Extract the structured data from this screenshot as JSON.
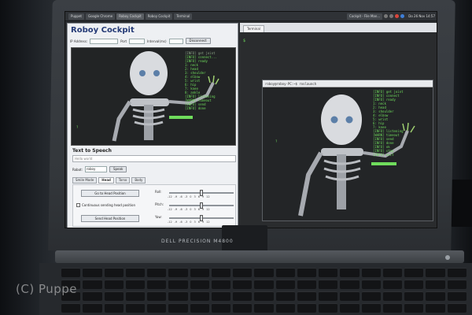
{
  "watermark": "(C) Puppe",
  "laptop": {
    "brand": "DELL PRECISION M4800"
  },
  "taskbar": {
    "tasks": [
      "Puppet",
      "Google Chrome",
      "Roboy Cockpit",
      "Roboy Cockpit",
      "Terminal",
      "Cockpit - File Man..."
    ],
    "clock": "Do 26 Nov 14:57"
  },
  "cockpit": {
    "title": "Roboy Cockpit",
    "ip_label": "IP Address:",
    "ip_value": "",
    "port_label": "Port",
    "interval_label": "Interval(ms)",
    "connect_button": "Disconnect",
    "terminal_lines": [
      "[INFO] get joint",
      "[INFO] connect...",
      "[INFO] ready",
      "1: neck",
      "2: head",
      "3: shoulder",
      "4: elbow",
      "5: wrist",
      "6: hip",
      "7: knee",
      "8: ankle",
      "[INFO] listening",
      "[WARN] timeout",
      "[INFO] send",
      "[INFO] done"
    ],
    "prompt": "?",
    "tts_title": "Text to Speech",
    "tts_placeholder": "Hello world",
    "robot_label": "Robot:",
    "robot_value": "roboy",
    "speak_button": "Speak",
    "tabs": [
      "Smile Mode",
      "Head",
      "Torso",
      "Body"
    ],
    "go_home_button": "Go to Head Position",
    "continuous_label": "Continuous sending head position",
    "send_head_button": "Send Head Position",
    "roll_label": "Roll:",
    "pitch_label": "Pitch:",
    "yaw_label": "Yaw:",
    "ticks": [
      "-12",
      "-9",
      "-6",
      "-3",
      "0",
      "3",
      "6",
      "9",
      "12"
    ]
  },
  "right_pane": {
    "tabs": [
      "Terminal"
    ],
    "prompt": "$",
    "cam_window_title": "roboy@roboy-PC:~$ roslaunch",
    "terminal_lines": [
      "[INFO] get joint",
      "[INFO] connect",
      "[INFO] ready",
      "1: neck",
      "2: head",
      "3: shoulder",
      "4: elbow",
      "5: wrist",
      "6: hip",
      "7: knee",
      "[INFO] listening",
      "[WARN] timeout",
      "[INFO] send",
      "[INFO] done",
      "[INFO] ok",
      "[INFO] stop",
      "[INFO] exit"
    ],
    "cam_prompt": "?"
  }
}
